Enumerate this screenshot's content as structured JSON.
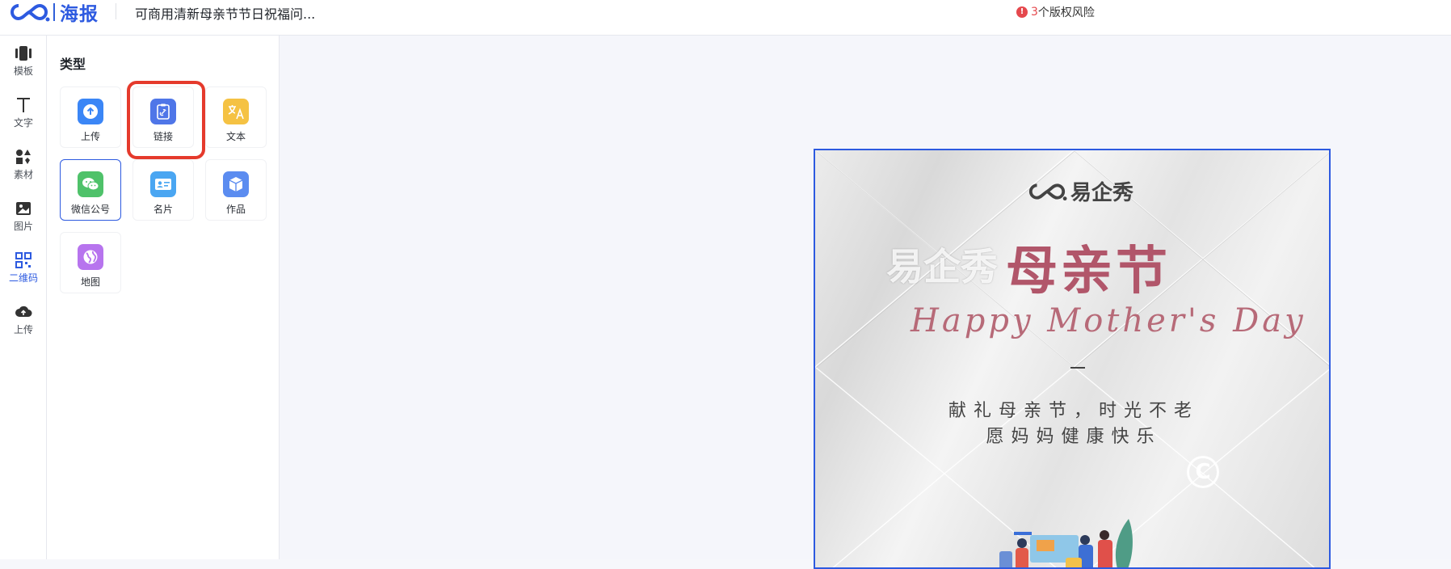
{
  "app": {
    "logo_text": "海报",
    "document_title": "可商用清新母亲节节日祝福问...",
    "risk": {
      "count": "3",
      "text": "个版权风险"
    }
  },
  "rail": {
    "items": [
      {
        "label": "模板",
        "icon": "template-icon"
      },
      {
        "label": "文字",
        "icon": "text-icon"
      },
      {
        "label": "素材",
        "icon": "shapes-icon"
      },
      {
        "label": "图片",
        "icon": "image-icon"
      },
      {
        "label": "二维码",
        "icon": "qrcode-icon",
        "active": true
      },
      {
        "label": "上传",
        "icon": "cloud-upload-icon"
      }
    ]
  },
  "panel": {
    "title": "类型",
    "tiles": [
      {
        "label": "上传",
        "icon": "upload-icon",
        "color": "#3b86f6"
      },
      {
        "label": "链接",
        "icon": "link-icon",
        "color": "#4f76e8"
      },
      {
        "label": "文本",
        "icon": "translate-icon",
        "color": "#f5c243"
      },
      {
        "label": "微信公号",
        "icon": "wechat-icon",
        "color": "#4fc26a",
        "selected": true
      },
      {
        "label": "名片",
        "icon": "business-card-icon",
        "color": "#4aa6f2"
      },
      {
        "label": "作品",
        "icon": "box-icon",
        "color": "#5b8cf0"
      },
      {
        "label": "地图",
        "icon": "globe-icon",
        "color": "#b774ee"
      }
    ]
  },
  "poster": {
    "brand": "易企秀",
    "watermark": "易企秀",
    "headline": "母亲节",
    "script_line": "Happy Mother's Day",
    "line1": "献礼母亲节，时光不老",
    "line2": "愿妈妈健康快乐",
    "copyright_mark": "C"
  }
}
